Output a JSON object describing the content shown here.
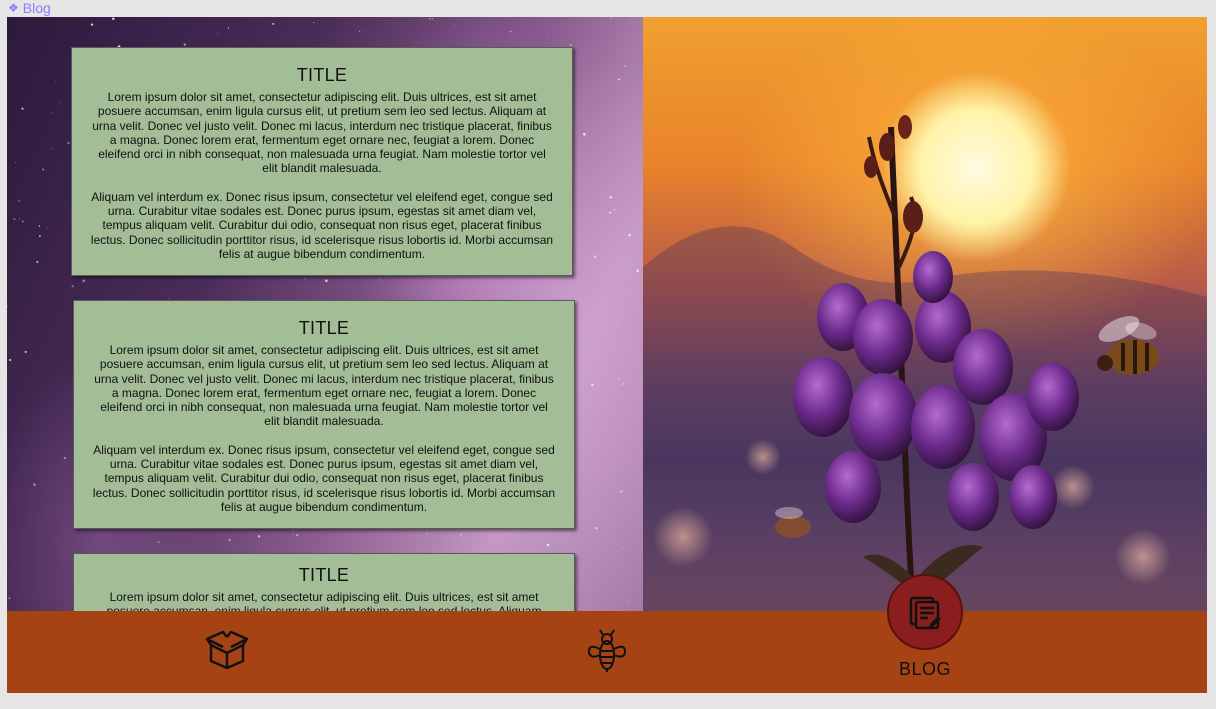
{
  "frame_label": {
    "icon": "component-diamond-icon",
    "text": "Blog"
  },
  "cards": [
    {
      "title": "TITLE",
      "p1": "Lorem ipsum dolor sit amet, consectetur adipiscing elit. Duis ultrices, est sit amet posuere accumsan, enim ligula cursus elit, ut pretium sem leo sed lectus. Aliquam at urna velit. Donec vel justo velit. Donec mi lacus, interdum nec tristique placerat, finibus a magna. Donec lorem erat, fermentum eget ornare nec, feugiat a lorem. Donec eleifend orci in nibh consequat, non malesuada urna feugiat. Nam molestie tortor vel elit blandit malesuada.",
      "p2": "Aliquam vel interdum ex. Donec risus ipsum, consectetur vel eleifend eget, congue sed urna. Curabitur vitae sodales est. Donec purus ipsum, egestas sit amet diam vel, tempus aliquam velit. Curabitur dui odio, consequat non risus eget, placerat finibus lectus. Donec sollicitudin porttitor risus, id scelerisque risus lobortis id. Morbi accumsan felis at augue bibendum condimentum."
    },
    {
      "title": "TITLE",
      "p1": "Lorem ipsum dolor sit amet, consectetur adipiscing elit. Duis ultrices, est sit amet posuere accumsan, enim ligula cursus elit, ut pretium sem leo sed lectus. Aliquam at urna velit. Donec vel justo velit. Donec mi lacus, interdum nec tristique placerat, finibus a magna. Donec lorem erat, fermentum eget ornare nec, feugiat a lorem. Donec eleifend orci in nibh consequat, non malesuada urna feugiat. Nam molestie tortor vel elit blandit malesuada.",
      "p2": "Aliquam vel interdum ex. Donec risus ipsum, consectetur vel eleifend eget, congue sed urna. Curabitur vitae sodales est. Donec purus ipsum, egestas sit amet diam vel, tempus aliquam velit. Curabitur dui odio, consequat non risus eget, placerat finibus lectus. Donec sollicitudin porttitor risus, id scelerisque risus lobortis id. Morbi accumsan felis at augue bibendum condimentum."
    },
    {
      "title": "TITLE",
      "p1": "Lorem ipsum dolor sit amet, consectetur adipiscing elit. Duis ultrices, est sit amet posuere accumsan, enim ligula cursus elit, ut pretium sem leo sed lectus. Aliquam"
    }
  ],
  "nav": {
    "home_icon": "open-box-icon",
    "bee_icon": "bee-icon",
    "blog_icon": "blog-document-icon",
    "blog_label": "BLOG"
  },
  "colors": {
    "card_bg": "#a3bd96",
    "nav_bg": "#a54314",
    "blog_button_bg": "#8a1e1e"
  }
}
